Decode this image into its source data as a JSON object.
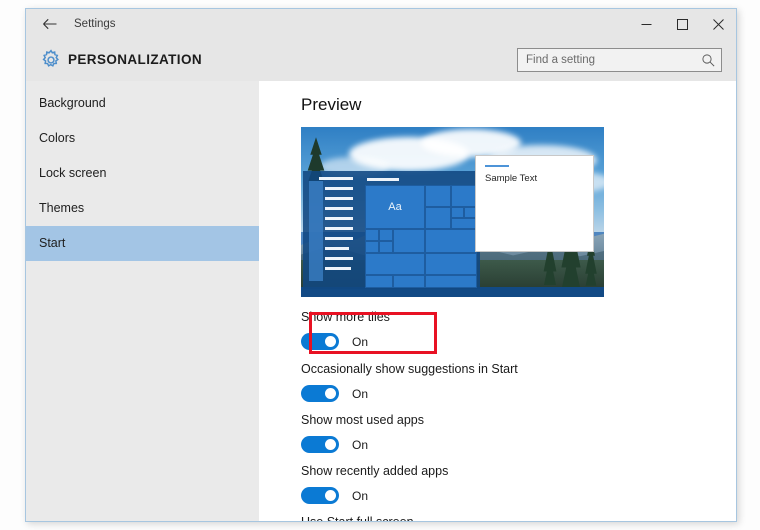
{
  "window": {
    "back_icon": "back-arrow-icon",
    "title": "Settings",
    "minimize_icon": "minimize-icon",
    "maximize_icon": "maximize-icon",
    "close_icon": "close-icon"
  },
  "header": {
    "gear_icon": "gear-icon",
    "page_title": "PERSONALIZATION",
    "search": {
      "placeholder": "Find a setting",
      "value": "",
      "icon": "search-icon"
    }
  },
  "sidebar": {
    "items": [
      {
        "label": "Background",
        "selected": false
      },
      {
        "label": "Colors",
        "selected": false
      },
      {
        "label": "Lock screen",
        "selected": false
      },
      {
        "label": "Themes",
        "selected": false
      },
      {
        "label": "Start",
        "selected": true
      }
    ],
    "selected_color": "#a3c5e5",
    "background_color": "#eaeaea"
  },
  "main": {
    "section_title": "Preview",
    "preview": {
      "sample_card_text": "Sample Text",
      "tile_label": "Aa",
      "accent_color": "#2c7ac9",
      "start_menu_color": "#114882",
      "taskbar_color": "#124a85"
    },
    "settings": [
      {
        "label": "Show more tiles",
        "state": "On",
        "toggle_on": true,
        "highlighted": true
      },
      {
        "label": "Occasionally show suggestions in Start",
        "state": "On",
        "toggle_on": true,
        "highlighted": false
      },
      {
        "label": "Show most used apps",
        "state": "On",
        "toggle_on": true,
        "highlighted": false
      },
      {
        "label": "Show recently added apps",
        "state": "On",
        "toggle_on": true,
        "highlighted": false
      },
      {
        "label": "Use Start full screen",
        "state": "",
        "toggle_on": true,
        "highlighted": false,
        "clipped": true
      }
    ],
    "annotation_color": "#e81123",
    "toggle_on_color": "#0b7ad4"
  }
}
